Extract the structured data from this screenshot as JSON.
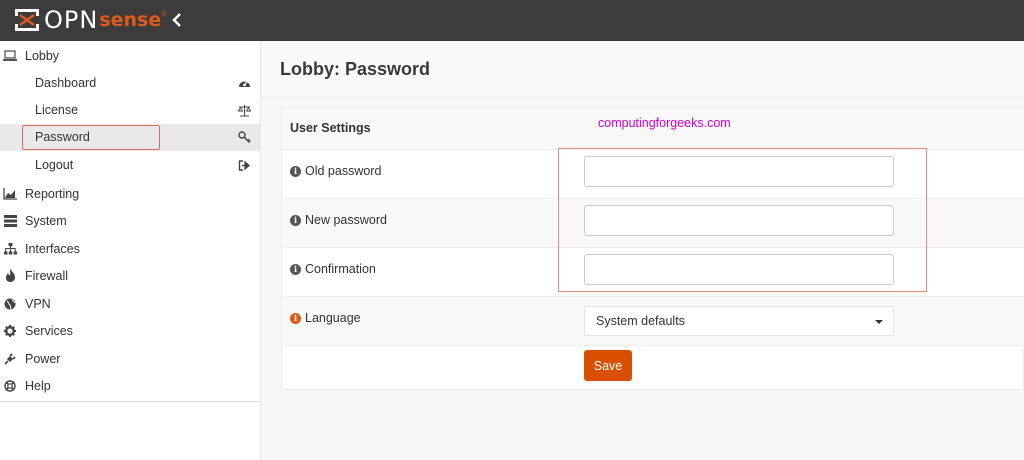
{
  "brand": {
    "name_main": "OPN",
    "name_accent": "sense",
    "registered": "®"
  },
  "sidebar": {
    "lobby": {
      "label": "Lobby",
      "icon": "laptop-icon"
    },
    "lobby_items": [
      {
        "label": "Dashboard",
        "icon": "dashboard-icon"
      },
      {
        "label": "License",
        "icon": "balance-scale-icon"
      },
      {
        "label": "Password",
        "icon": "key-icon",
        "active": true
      },
      {
        "label": "Logout",
        "icon": "sign-out-icon"
      }
    ],
    "items": [
      {
        "label": "Reporting",
        "icon": "area-chart-icon"
      },
      {
        "label": "System",
        "icon": "server-icon"
      },
      {
        "label": "Interfaces",
        "icon": "sitemap-icon"
      },
      {
        "label": "Firewall",
        "icon": "fire-icon"
      },
      {
        "label": "VPN",
        "icon": "globe-icon"
      },
      {
        "label": "Services",
        "icon": "cog-icon"
      },
      {
        "label": "Power",
        "icon": "plug-icon"
      },
      {
        "label": "Help",
        "icon": "life-ring-icon"
      }
    ]
  },
  "page": {
    "title": "Lobby: Password"
  },
  "form": {
    "section_title": "User Settings",
    "watermark": "computingforgeeks.com",
    "old_password_label": "Old password",
    "new_password_label": "New password",
    "confirmation_label": "Confirmation",
    "language_label": "Language",
    "language_value": "System defaults",
    "save_label": "Save"
  },
  "colors": {
    "accent": "#d94f00",
    "topbar": "#3c3c3c",
    "highlight": "#e06a6a",
    "watermark": "#d100d1"
  }
}
